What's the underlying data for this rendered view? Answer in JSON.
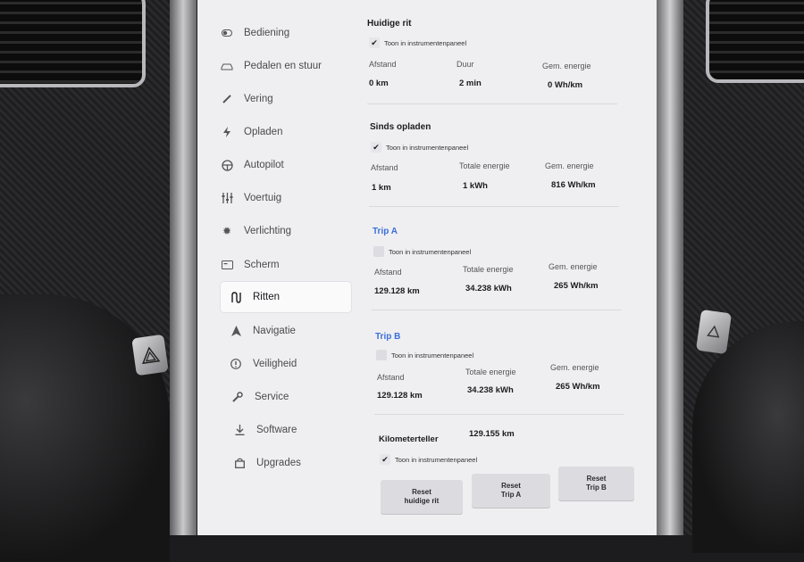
{
  "sidebar": {
    "items": [
      {
        "label": "Bediening",
        "icon": "toggle-icon"
      },
      {
        "label": "Pedalen en stuur",
        "icon": "car-icon"
      },
      {
        "label": "Vering",
        "icon": "suspension-icon"
      },
      {
        "label": "Opladen",
        "icon": "lightning-icon"
      },
      {
        "label": "Autopilot",
        "icon": "steering-wheel-icon"
      },
      {
        "label": "Voertuig",
        "icon": "sliders-icon"
      },
      {
        "label": "Verlichting",
        "icon": "sun-icon"
      },
      {
        "label": "Scherm",
        "icon": "display-icon"
      },
      {
        "label": "Ritten",
        "icon": "trips-icon",
        "active": true
      },
      {
        "label": "Navigatie",
        "icon": "navigation-arrow-icon"
      },
      {
        "label": "Veiligheid",
        "icon": "info-circle-icon"
      },
      {
        "label": "Service",
        "icon": "wrench-icon"
      },
      {
        "label": "Software",
        "icon": "download-icon"
      },
      {
        "label": "Upgrades",
        "icon": "bag-icon"
      }
    ]
  },
  "checkbox_label": "Toon in instrumentenpaneel",
  "current_trip": {
    "title": "Huidige rit",
    "checked": true,
    "labels": [
      "Afstand",
      "Duur",
      "Gem. energie"
    ],
    "values": [
      "0 km",
      "2 min",
      "0 Wh/km"
    ]
  },
  "since_charge": {
    "title": "Sinds opladen",
    "checked": true,
    "labels": [
      "Afstand",
      "Totale energie",
      "Gem. energie"
    ],
    "values": [
      "1 km",
      "1 kWh",
      "816 Wh/km"
    ]
  },
  "trip_a": {
    "title": "Trip A",
    "checked": false,
    "labels": [
      "Afstand",
      "Totale energie",
      "Gem. energie"
    ],
    "values": [
      "129.128 km",
      "34.238 kWh",
      "265 Wh/km"
    ]
  },
  "trip_b": {
    "title": "Trip B",
    "checked": false,
    "labels": [
      "Afstand",
      "Totale energie",
      "Gem. energie"
    ],
    "values": [
      "129.128 km",
      "34.238 kWh",
      "265 Wh/km"
    ]
  },
  "odometer": {
    "label": "Kilometerteller",
    "value": "129.155 km",
    "checked": true
  },
  "buttons": {
    "reset_current": [
      "Reset",
      "huidige rit"
    ],
    "reset_a": [
      "Reset",
      "Trip A"
    ],
    "reset_b": [
      "Reset",
      "Trip B"
    ]
  },
  "colors": {
    "accent_blue": "#3b6fd9",
    "screen_bg": "#efeff1"
  }
}
